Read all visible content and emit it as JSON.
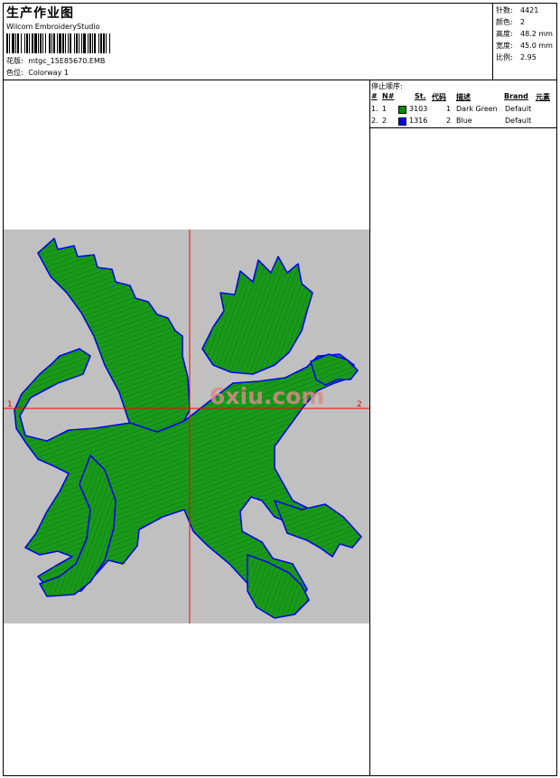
{
  "header": {
    "title": "生产作业图",
    "software": "Wilcom EmbroideryStudio",
    "design_label": "花版:",
    "design_file": "mtgc_15E85670.EMB",
    "colorway_label": "色位:",
    "colorway": "Colorway 1"
  },
  "stats": [
    {
      "label": "针数:",
      "value": "4421"
    },
    {
      "label": "颜色:",
      "value": "2"
    },
    {
      "label": "高度:",
      "value": "48.2 mm"
    },
    {
      "label": "宽度:",
      "value": "45.0 mm"
    },
    {
      "label": "比例:",
      "value": "2.95"
    }
  ],
  "stop_sequence": {
    "label": "停止顺序:",
    "columns": [
      "#",
      "N#",
      "St.",
      "代码",
      "描述",
      "Brand",
      "元素"
    ],
    "rows": [
      {
        "index": "1.",
        "n": "1",
        "color": "#0a8a0a",
        "st": "3103",
        "code": "1",
        "desc": "Dark Green",
        "brand": "Default"
      },
      {
        "index": "2.",
        "n": "2",
        "color": "#0000ff",
        "st": "1316",
        "code": "2",
        "desc": "Blue",
        "brand": "Default"
      }
    ]
  },
  "design": {
    "axis_label_left": "1",
    "axis_label_right": "2",
    "watermark": "6xiu.com",
    "fill_color": "#1a9a1a",
    "outline_color": "#0000ee",
    "crosshair_color": "#ff0000",
    "background_color": "#c0c0c0"
  }
}
